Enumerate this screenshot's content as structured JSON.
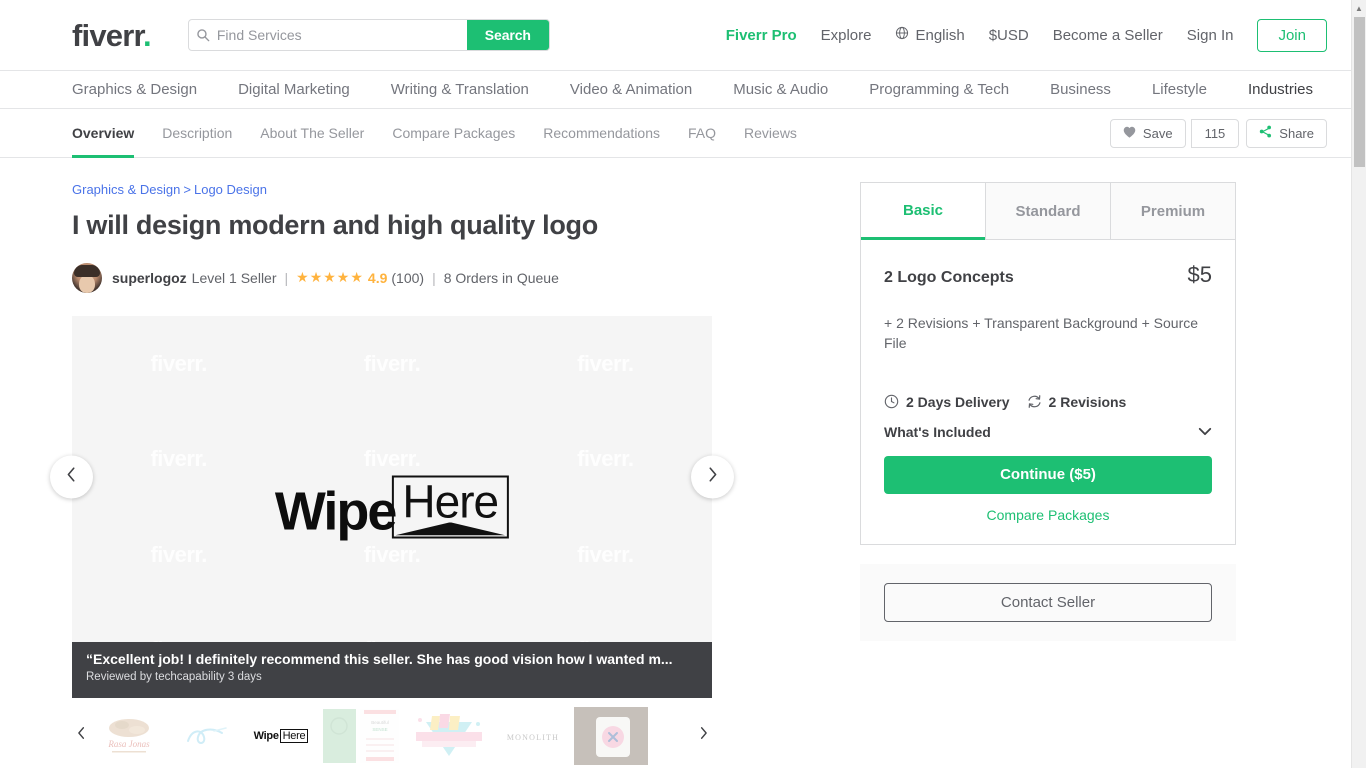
{
  "header": {
    "logo": "fiverr",
    "logo_dot": ".",
    "search": {
      "placeholder": "Find Services",
      "value": "",
      "button": "Search",
      "icon": "search-icon"
    },
    "links": [
      {
        "label": "Fiverr Pro",
        "style": "pro"
      },
      {
        "label": "Explore",
        "style": "plain"
      },
      {
        "label": "English",
        "style": "plain",
        "icon": "globe-icon"
      },
      {
        "label": "$USD",
        "style": "plain"
      },
      {
        "label": "Become a Seller",
        "style": "plain"
      },
      {
        "label": "Sign In",
        "style": "plain"
      }
    ],
    "join_label": "Join"
  },
  "category_nav": {
    "items": [
      "Graphics & Design",
      "Digital Marketing",
      "Writing & Translation",
      "Video & Animation",
      "Music & Audio",
      "Programming & Tech",
      "Business",
      "Lifestyle",
      "Industries"
    ]
  },
  "sub_nav": {
    "tabs": [
      {
        "label": "Overview",
        "active": true
      },
      {
        "label": "Description",
        "active": false
      },
      {
        "label": "About The Seller",
        "active": false
      },
      {
        "label": "Compare Packages",
        "active": false
      },
      {
        "label": "Recommendations",
        "active": false
      },
      {
        "label": "FAQ",
        "active": false
      },
      {
        "label": "Reviews",
        "active": false
      }
    ],
    "save_label": "Save",
    "save_icon": "heart-icon",
    "save_count": "115",
    "share_label": "Share",
    "share_icon": "share-icon"
  },
  "gig": {
    "breadcrumb": {
      "parent": "Graphics & Design",
      "separator": ">",
      "child": "Logo Design"
    },
    "title": "I will design modern and high quality logo",
    "seller": {
      "avatar": "seller-avatar",
      "name": "superlogoz",
      "level": "Level 1 Seller",
      "stars": "★★★★★",
      "rating": "4.9",
      "rating_count": "(100)",
      "orders_in_queue": "8 Orders in Queue"
    },
    "gallery": {
      "watermark": "fiverr",
      "watermark_dot": ".",
      "logo_primary": "Wipe",
      "logo_secondary": "Here",
      "prev_icon": "chevron-left-icon",
      "next_icon": "chevron-right-icon",
      "review_quote": "“Excellent job! I definitely recommend this seller. She has good vision how I wanted m...",
      "review_meta": "Reviewed by techcapability 3 days"
    },
    "thumbnails": {
      "prev_icon": "chevron-left-icon",
      "next_icon": "chevron-right-icon",
      "items": [
        {
          "name": "thumb-rasa-jonas-logo",
          "active": false
        },
        {
          "name": "thumb-blue-script-logo",
          "active": false
        },
        {
          "name": "thumb-wipe-here-logo",
          "active": true
        },
        {
          "name": "thumb-green-brochure",
          "active": false
        },
        {
          "name": "thumb-party-banner",
          "active": false
        },
        {
          "name": "thumb-monochrome-wordmark",
          "active": false
        },
        {
          "name": "thumb-packaging-mockup",
          "active": false
        }
      ]
    }
  },
  "package": {
    "tabs": [
      {
        "label": "Basic",
        "active": true
      },
      {
        "label": "Standard",
        "active": false
      },
      {
        "label": "Premium",
        "active": false
      }
    ],
    "name": "2 Logo Concepts",
    "price": "$5",
    "description": "+ 2 Revisions + Transparent Background + Source File",
    "delivery": {
      "icon": "clock-icon",
      "label": "2 Days Delivery"
    },
    "revisions": {
      "icon": "refresh-icon",
      "label": "2 Revisions"
    },
    "whats_included": "What's Included",
    "whats_included_icon": "chevron-down-icon",
    "continue_label": "Continue ($5)",
    "compare_label": "Compare Packages",
    "contact_label": "Contact Seller"
  },
  "colors": {
    "brand_green": "#1dbf73",
    "text_dark": "#404145",
    "text_muted": "#62646a",
    "link_blue": "#4a73e8",
    "star_gold": "#ffb33e",
    "overlay_dark": "#404145"
  }
}
